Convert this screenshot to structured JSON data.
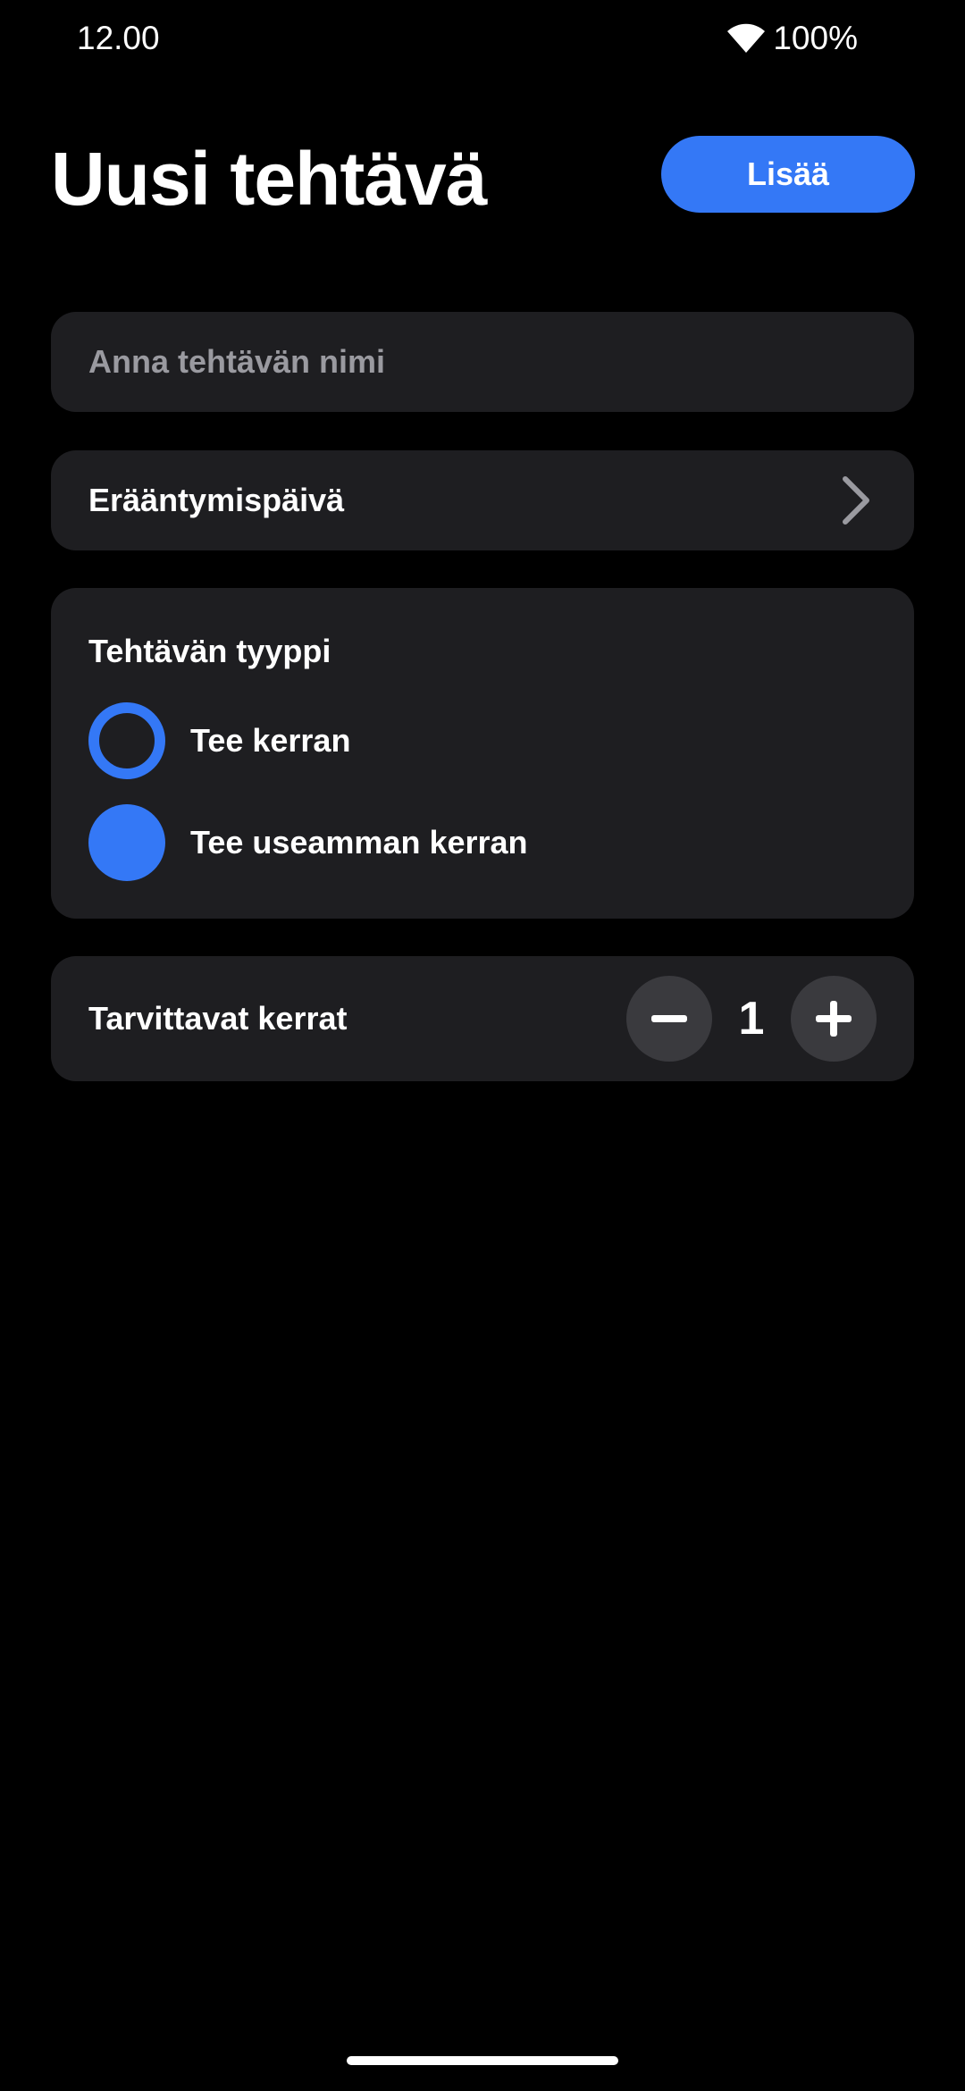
{
  "status_bar": {
    "time": "12.00",
    "battery": "100%",
    "wifi_icon": "wifi-icon"
  },
  "header": {
    "title": "Uusi tehtävä",
    "add_label": "Lisää"
  },
  "colors": {
    "accent": "#3478f6",
    "card_background": "#1e1e21",
    "page_background": "#000000"
  },
  "form": {
    "name_placeholder": "Anna tehtävän nimi",
    "name_value": "",
    "due_date_label": "Erääntymispäivä",
    "task_type": {
      "heading": "Tehtävän tyyppi",
      "options": [
        {
          "label": "Tee kerran",
          "selected": false
        },
        {
          "label": "Tee useamman kerran",
          "selected": true
        }
      ]
    },
    "repetitions": {
      "label": "Tarvittavat kerrat",
      "value": "1"
    }
  }
}
